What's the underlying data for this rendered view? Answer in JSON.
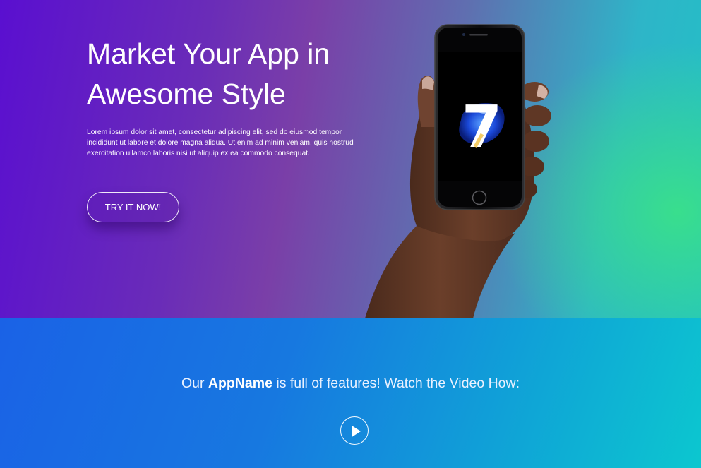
{
  "hero": {
    "title_line1": "Market Your App in",
    "title_line2": "Awesome Style",
    "description": "Lorem ipsum dolor sit amet, consectetur adipiscing elit, sed do eiusmod tempor incididunt ut labore et dolore magna aliqua. Ut enim ad minim veniam, quis nostrud exercitation ullamco laboris nisi ut aliquip ex ea commodo consequat.",
    "cta_label": "TRY IT NOW!",
    "phone_screen_numeral": "7"
  },
  "features": {
    "text_before": "Our ",
    "app_name": "AppName",
    "text_after": " is full of features! Watch the Video How:"
  },
  "icons": {
    "play": "play-icon",
    "phone": "phone-in-hand-illustration"
  },
  "colors": {
    "hero_gradient_start": "#5a0fd0",
    "hero_gradient_end": "#22c0c6",
    "hero_glow": "#3ae08a",
    "features_gradient_start": "#1a62e6",
    "features_gradient_end": "#0cc7cf"
  }
}
